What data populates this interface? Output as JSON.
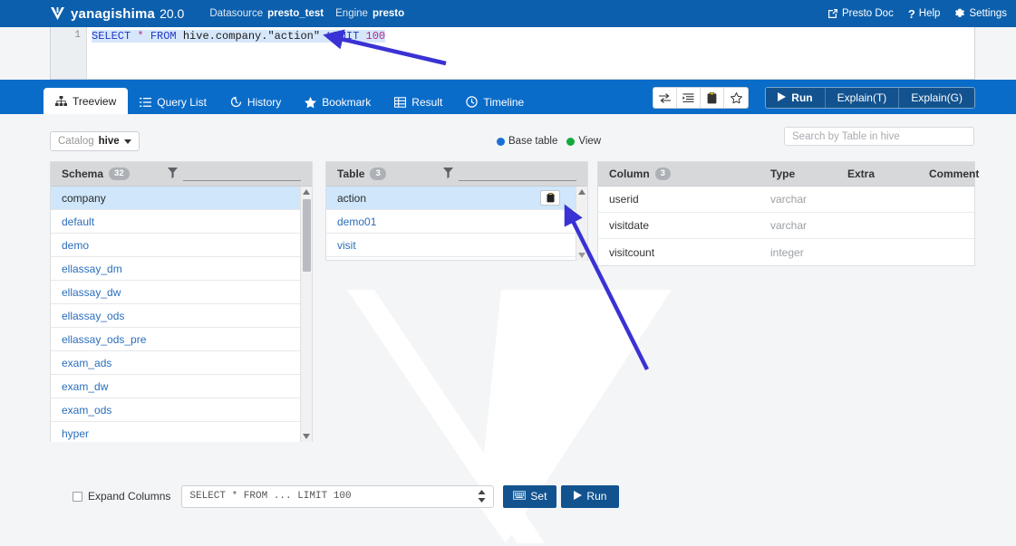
{
  "header": {
    "brand": "yanagishima",
    "version": "20.0",
    "datasource_label": "Datasource",
    "datasource_value": "presto_test",
    "engine_label": "Engine",
    "engine_value": "presto",
    "links": [
      {
        "label": "Presto Doc",
        "icon": "external-link-icon"
      },
      {
        "label": "Help",
        "icon": "question-icon"
      },
      {
        "label": "Settings",
        "icon": "gear-icon"
      }
    ],
    "brand_color": "#0c5fad"
  },
  "editor": {
    "line_number": "1",
    "tokens": {
      "select": "SELECT",
      "star": "*",
      "from": "FROM",
      "identifier": "hive.company.",
      "quoted": "\"action\"",
      "limit": "LIMIT",
      "number": "100"
    },
    "full_query": "SELECT * FROM hive.company.\"action\" LIMIT 100"
  },
  "tabs": [
    {
      "label": "Treeview",
      "icon": "sitemap-icon",
      "active": true
    },
    {
      "label": "Query List",
      "icon": "list-icon",
      "active": false
    },
    {
      "label": "History",
      "icon": "history-icon",
      "active": false
    },
    {
      "label": "Bookmark",
      "icon": "star-icon",
      "active": false
    },
    {
      "label": "Result",
      "icon": "table-icon",
      "active": false
    },
    {
      "label": "Timeline",
      "icon": "clock-icon",
      "active": false
    }
  ],
  "toolbar": {
    "icon_buttons": [
      {
        "name": "swap-icon"
      },
      {
        "name": "format-indent-icon"
      },
      {
        "name": "clipboard-icon"
      },
      {
        "name": "star-outline-icon"
      }
    ],
    "run_label": "Run",
    "explain_t_label": "Explain(T)",
    "explain_g_label": "Explain(G)"
  },
  "treeview": {
    "catalog_label": "Catalog",
    "catalog_value": "hive",
    "legend": [
      {
        "label": "Base table",
        "color": "#1a6fd4"
      },
      {
        "label": "View",
        "color": "#15a93c"
      }
    ],
    "search_placeholder": "Search by Table in hive",
    "schema_panel": {
      "title": "Schema",
      "count": "32",
      "filter_icon": "filter-icon",
      "items": [
        {
          "label": "company",
          "selected": true
        },
        {
          "label": "default",
          "selected": false
        },
        {
          "label": "demo",
          "selected": false
        },
        {
          "label": "ellassay_dm",
          "selected": false
        },
        {
          "label": "ellassay_dw",
          "selected": false
        },
        {
          "label": "ellassay_ods",
          "selected": false
        },
        {
          "label": "ellassay_ods_pre",
          "selected": false
        },
        {
          "label": "exam_ads",
          "selected": false
        },
        {
          "label": "exam_dw",
          "selected": false
        },
        {
          "label": "exam_ods",
          "selected": false
        },
        {
          "label": "hyper",
          "selected": false
        }
      ]
    },
    "table_panel": {
      "title": "Table",
      "count": "3",
      "filter_icon": "filter-icon",
      "items": [
        {
          "label": "action",
          "selected": true,
          "has_clipboard": true
        },
        {
          "label": "demo01",
          "selected": false,
          "has_clipboard": false
        },
        {
          "label": "visit",
          "selected": false,
          "has_clipboard": false
        }
      ]
    },
    "column_panel": {
      "title": "Column",
      "count": "3",
      "headers": {
        "column": "Column",
        "type": "Type",
        "extra": "Extra",
        "comment": "Comment"
      },
      "rows": [
        {
          "column": "userid",
          "type": "varchar",
          "extra": "",
          "comment": ""
        },
        {
          "column": "visitdate",
          "type": "varchar",
          "extra": "",
          "comment": ""
        },
        {
          "column": "visitcount",
          "type": "integer",
          "extra": "",
          "comment": ""
        }
      ]
    }
  },
  "bottom_bar": {
    "expand_columns_label": "Expand Columns",
    "expand_columns_checked": false,
    "query_template": "SELECT * FROM ... LIMIT 100",
    "set_label": "Set",
    "run_label": "Run"
  },
  "annotations": {
    "arrow_color": "#3a32d4",
    "arrow_count": 2
  }
}
